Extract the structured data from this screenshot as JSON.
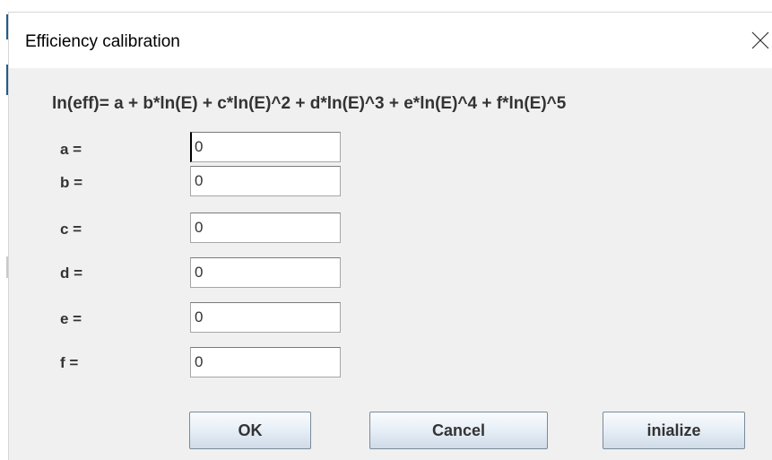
{
  "dialog": {
    "title": "Efficiency calibration",
    "formula": "ln(eff)= a + b*ln(E) + c*ln(E)^2 + d*ln(E)^3 + e*ln(E)^4 + f*ln(E)^5",
    "close_icon": "close-icon"
  },
  "coefficients": [
    {
      "label": "a =",
      "value": "0"
    },
    {
      "label": "b =",
      "value": "0"
    },
    {
      "label": "c =",
      "value": "0"
    },
    {
      "label": "d =",
      "value": "0"
    },
    {
      "label": "e =",
      "value": "0"
    },
    {
      "label": "f =",
      "value": "0"
    }
  ],
  "buttons": {
    "ok": "OK",
    "cancel": "Cancel",
    "initialize": "inialize"
  }
}
